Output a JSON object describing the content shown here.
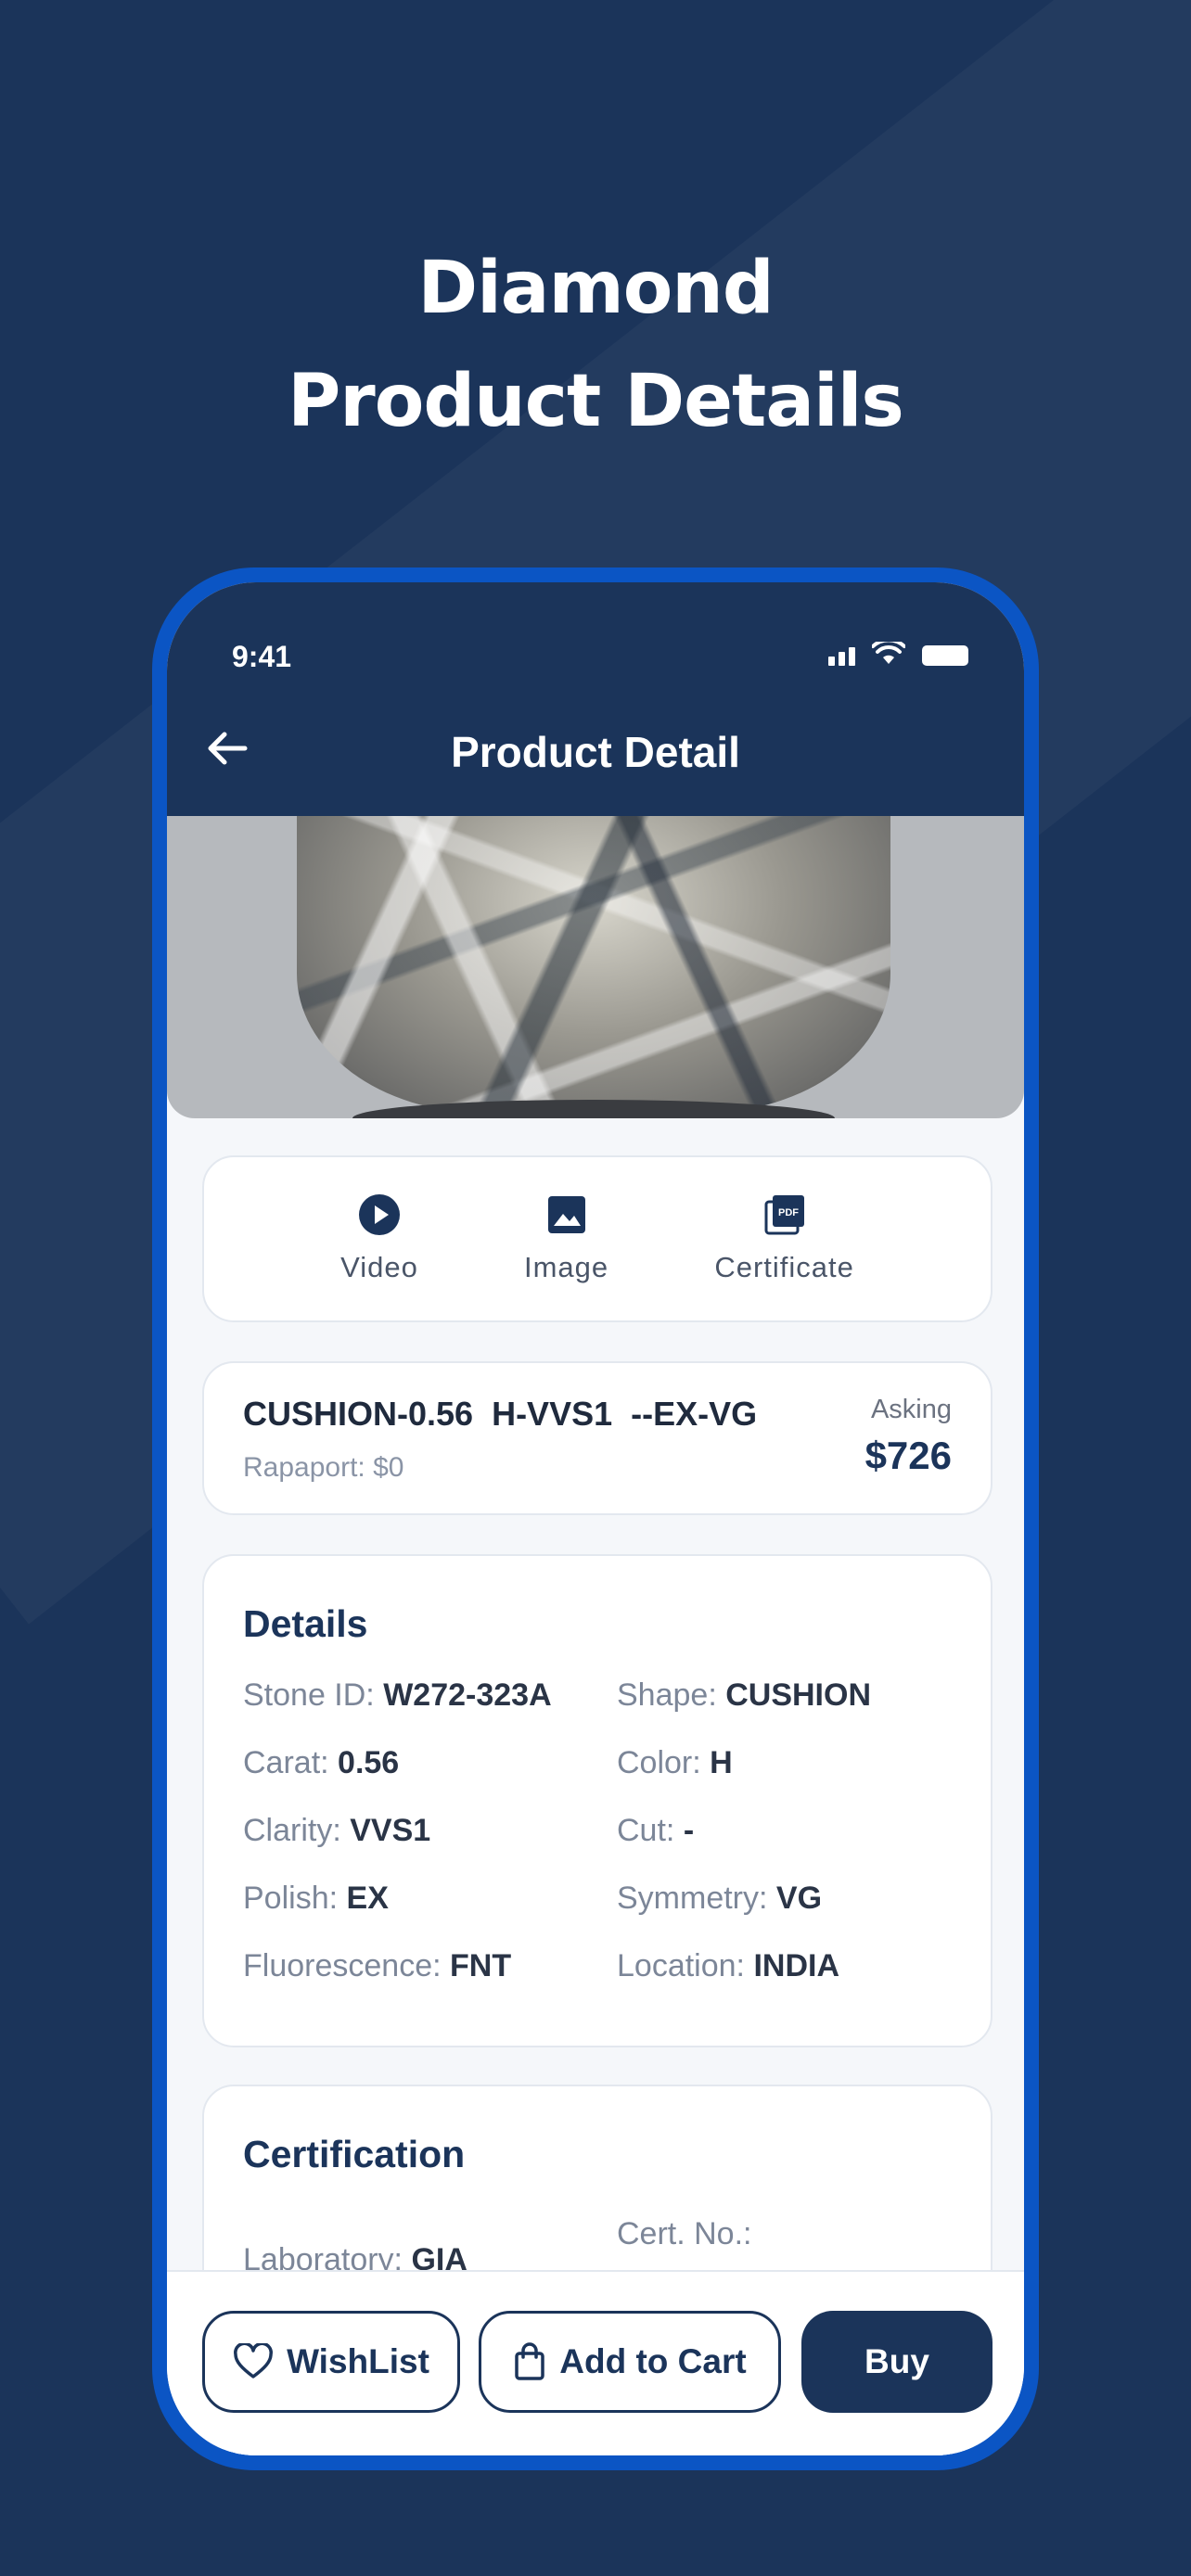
{
  "hero": {
    "line1": "Diamond",
    "line2": "Product Details"
  },
  "status_bar": {
    "time": "9:41"
  },
  "nav": {
    "title": "Product Detail"
  },
  "media": {
    "video_label": "Video",
    "image_label": "Image",
    "certificate_label": "Certificate",
    "video_icon": "play-circle-icon",
    "image_icon": "image-icon",
    "certificate_icon": "pdf-icon"
  },
  "summary": {
    "title": "CUSHION-0.56  H-VVS1  --EX-VG",
    "rapaport": "Rapaport: $0",
    "asking_label": "Asking",
    "asking_price": "$726"
  },
  "details": {
    "title": "Details",
    "stone_id_label": "Stone ID:",
    "stone_id": "W272-323A",
    "shape_label": "Shape:",
    "shape": "CUSHION",
    "carat_label": "Carat:",
    "carat": "0.56",
    "color_label": "Color:",
    "color": "H",
    "clarity_label": "Clarity:",
    "clarity": "VVS1",
    "cut_label": "Cut:",
    "cut": "-",
    "polish_label": "Polish:",
    "polish": "EX",
    "symmetry_label": "Symmetry:",
    "symmetry": "VG",
    "fluorescence_label": "Fluorescence:",
    "fluorescence": "FNT",
    "location_label": "Location:",
    "location": "INDIA"
  },
  "certification": {
    "title": "Certification",
    "lab_label": "Laboratory:",
    "lab": "GIA",
    "cert_no_label": "Cert. No.:"
  },
  "actions": {
    "wishlist": "WishList",
    "add_to_cart": "Add to Cart",
    "buy": "Buy"
  },
  "colors": {
    "background": "#1b345a",
    "phone_frame": "#0b55c4",
    "primary": "#1b345a"
  }
}
